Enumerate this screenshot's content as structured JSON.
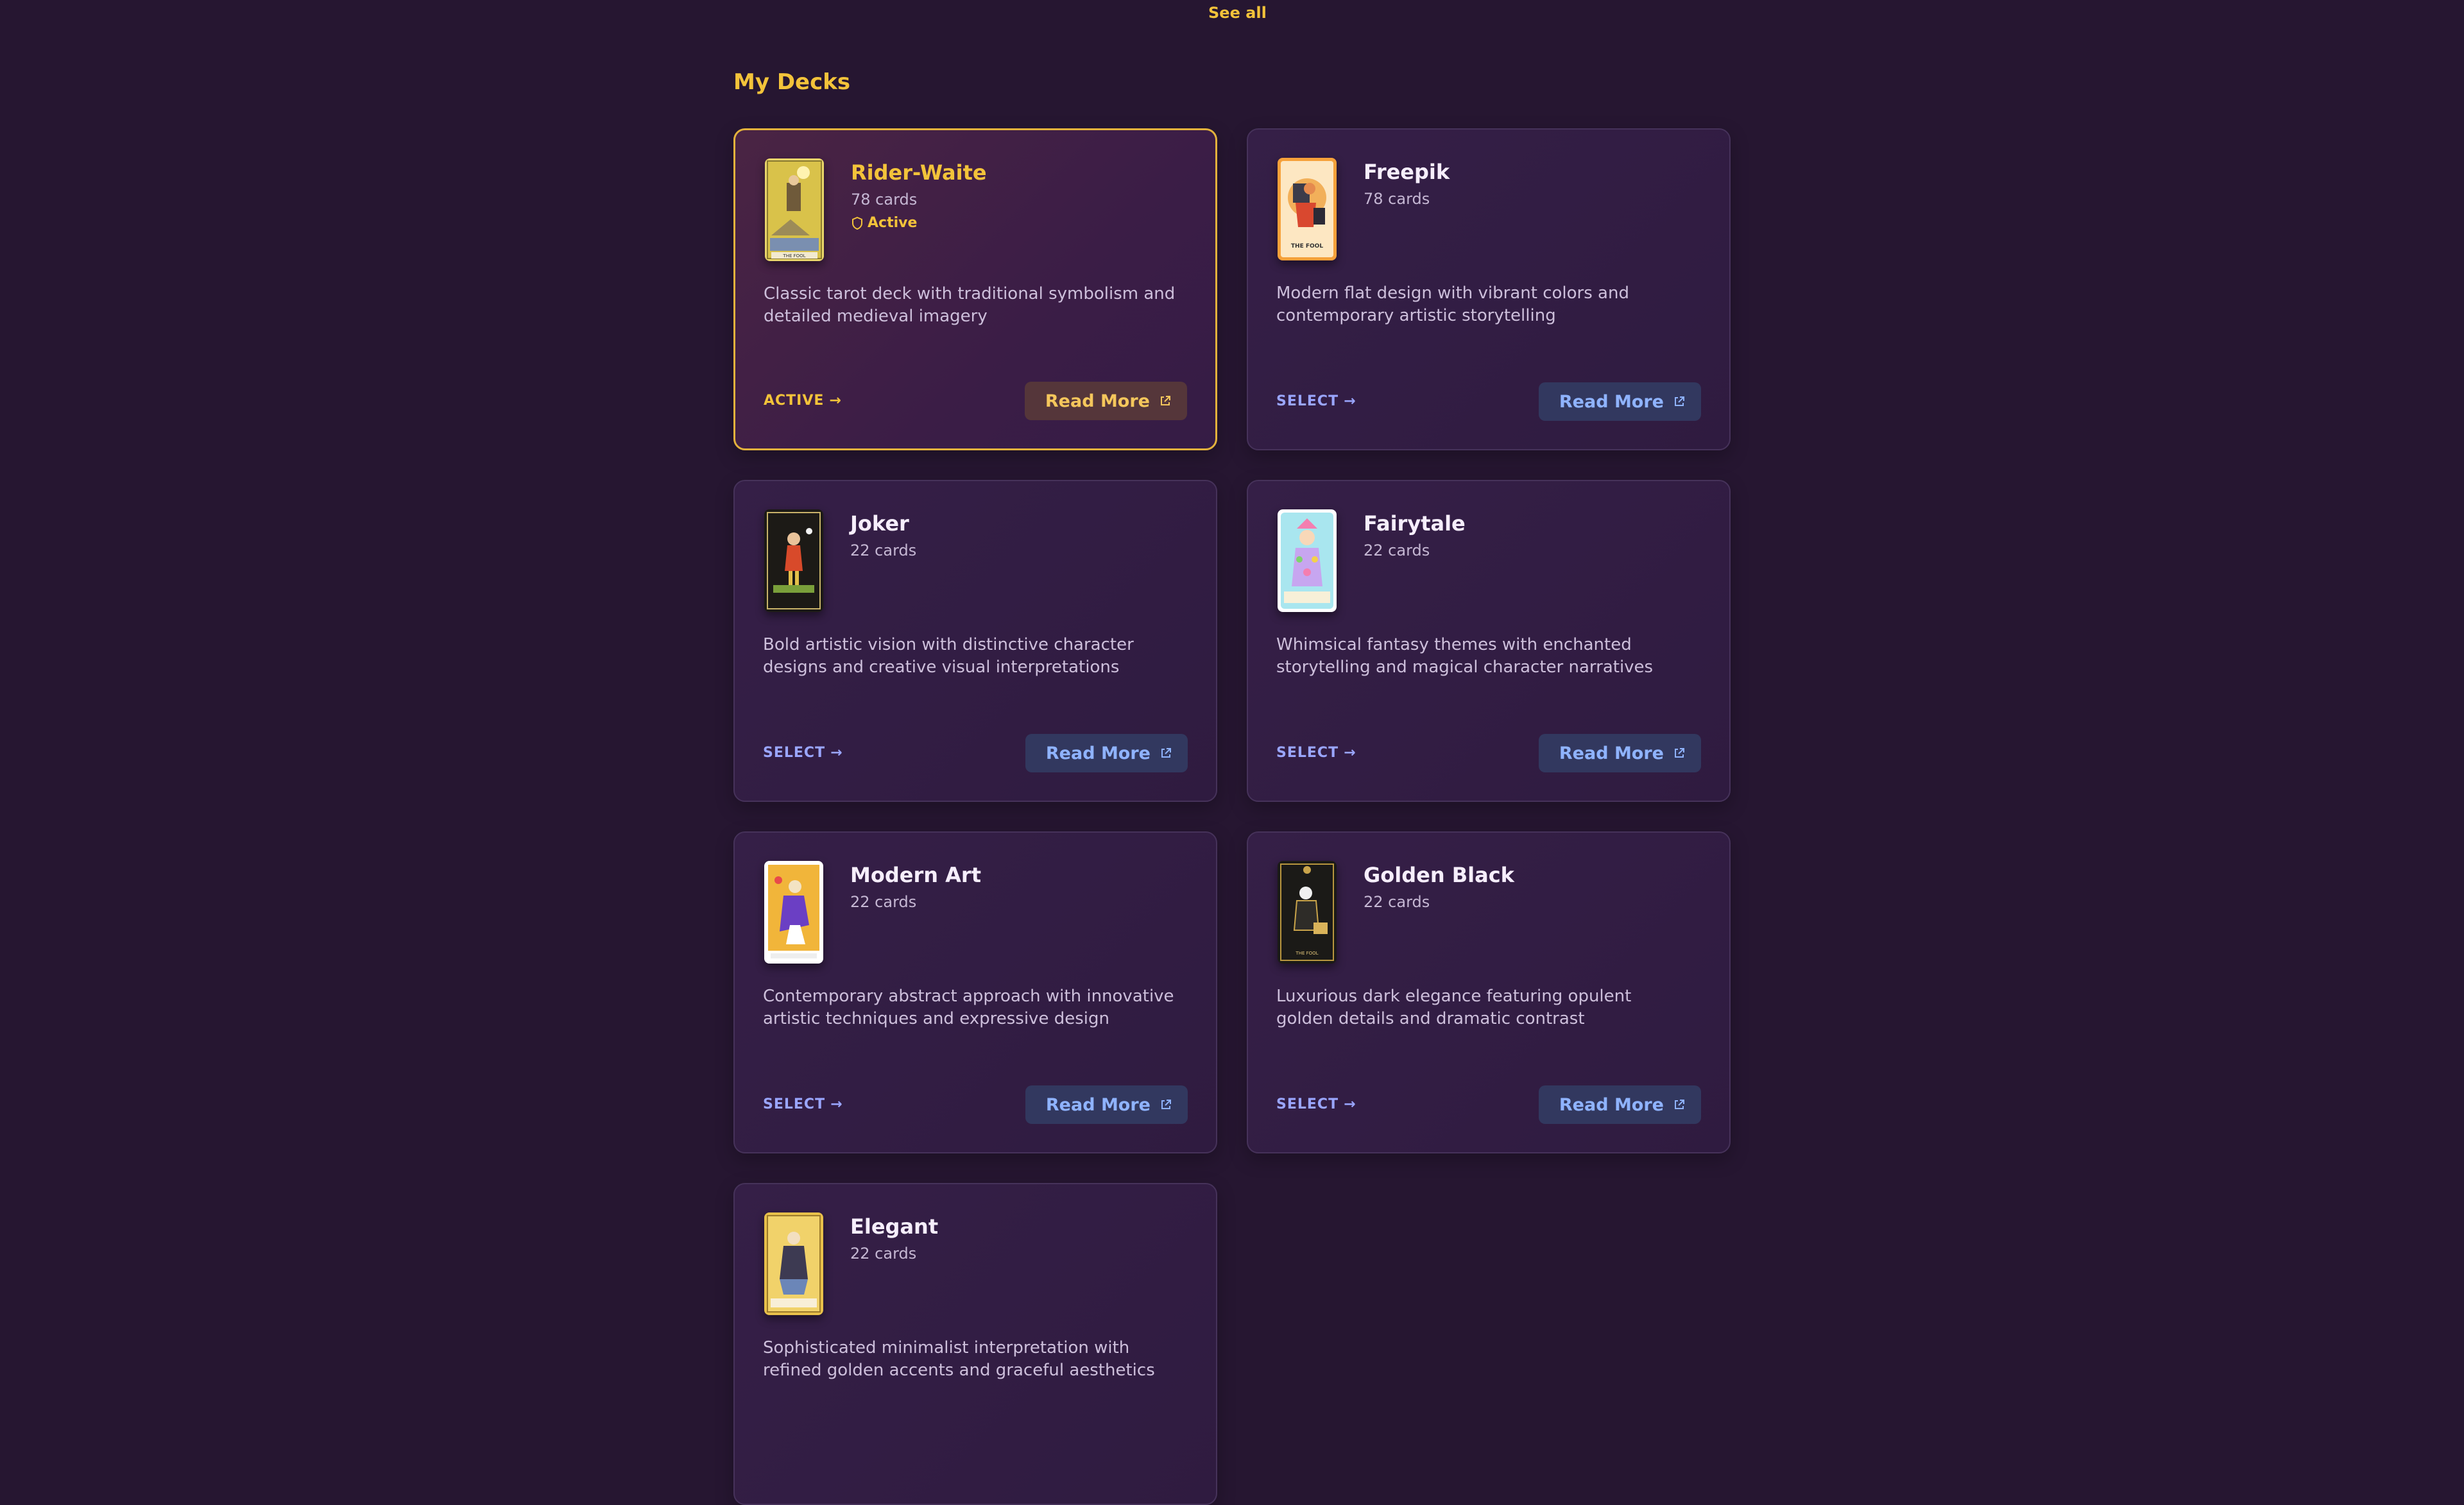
{
  "header": {
    "see_all": "See all"
  },
  "section": {
    "title": "My Decks"
  },
  "common": {
    "read_more": "Read More",
    "select": "SELECT",
    "arrow": "→"
  },
  "decks": [
    {
      "name": "Rider-Waite",
      "count": "78 cards",
      "status": "Active",
      "action": "ACTIVE",
      "description": "Classic tarot deck with traditional symbolism and detailed medieval imagery",
      "thumb_label": "THE FOOL"
    },
    {
      "name": "Freepik",
      "count": "78 cards",
      "action": "SELECT",
      "description": "Modern flat design with vibrant colors and contemporary artistic storytelling",
      "thumb_label": "THE FOOL"
    },
    {
      "name": "Joker",
      "count": "22 cards",
      "action": "SELECT",
      "description": "Bold artistic vision with distinctive character designs and creative visual interpretations"
    },
    {
      "name": "Fairytale",
      "count": "22 cards",
      "action": "SELECT",
      "description": "Whimsical fantasy themes with enchanted storytelling and magical character narratives"
    },
    {
      "name": "Modern Art",
      "count": "22 cards",
      "action": "SELECT",
      "description": "Contemporary abstract approach with innovative artistic techniques and expressive design"
    },
    {
      "name": "Golden Black",
      "count": "22 cards",
      "action": "SELECT",
      "description": "Luxurious dark elegance featuring opulent golden details and dramatic contrast",
      "thumb_label": "THE FOOL"
    },
    {
      "name": "Elegant",
      "count": "22 cards",
      "description": "Sophisticated minimalist interpretation with refined golden accents and graceful aesthetics"
    }
  ],
  "colors": {
    "accent": "#f3c33a",
    "link": "#9aa6ff",
    "button_text": "#8fb3ff",
    "background": "#261631"
  }
}
